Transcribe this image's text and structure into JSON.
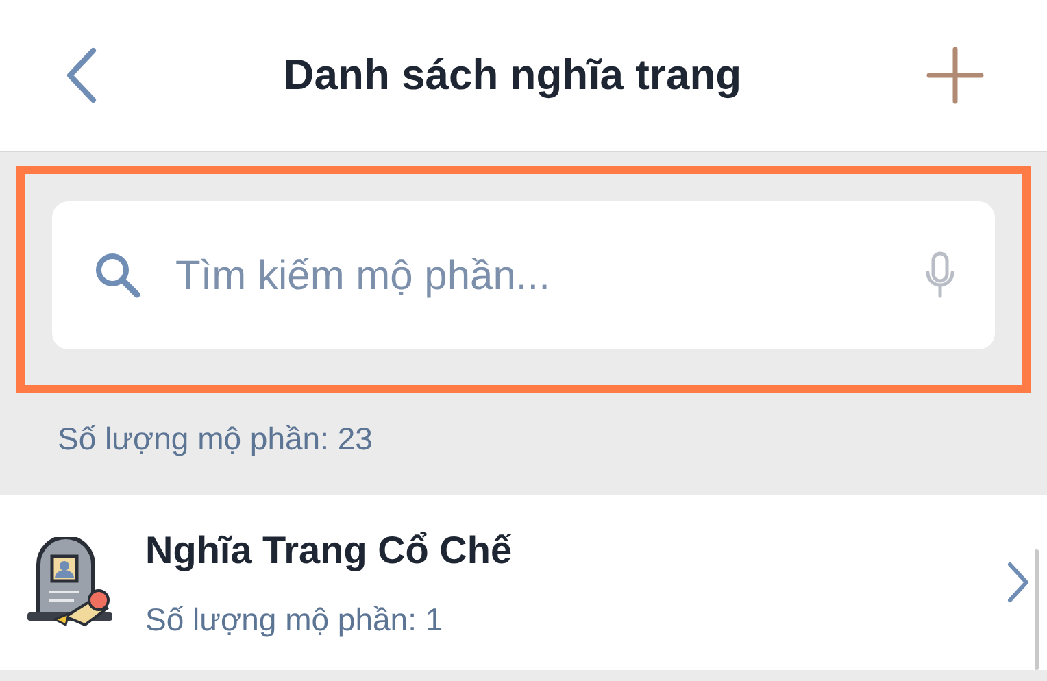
{
  "header": {
    "title": "Danh sách nghĩa trang"
  },
  "search": {
    "placeholder": "Tìm kiếm mộ phần...",
    "highlighted": true
  },
  "count_label": "Số lượng mộ phần: 23",
  "cemeteries": [
    {
      "name": "Nghĩa Trang Cổ Chế",
      "count": "Số lượng mộ phần: 1"
    }
  ]
}
